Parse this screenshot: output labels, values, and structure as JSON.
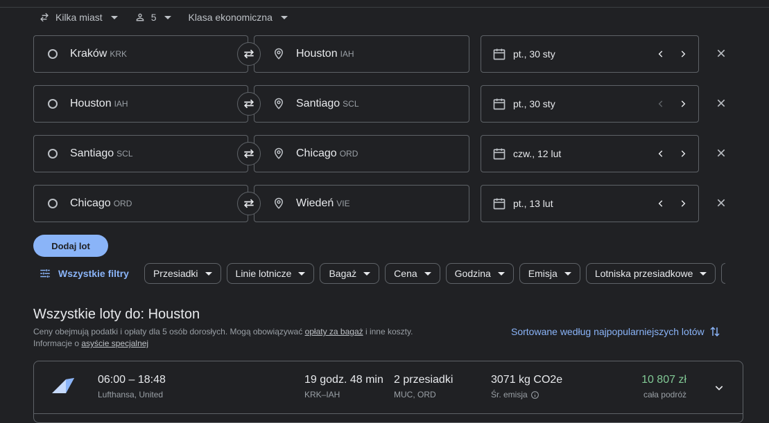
{
  "topbar": {
    "trip_type": "Kilka miast",
    "passengers": "5",
    "cabin_class": "Klasa ekonomiczna"
  },
  "legs": [
    {
      "from_city": "Kraków",
      "from_code": "KRK",
      "to_city": "Houston",
      "to_code": "IAH",
      "date": "pt., 30 sty",
      "prev_enabled": true
    },
    {
      "from_city": "Houston",
      "from_code": "IAH",
      "to_city": "Santiago",
      "to_code": "SCL",
      "date": "pt., 30 sty",
      "prev_enabled": false
    },
    {
      "from_city": "Santiago",
      "from_code": "SCL",
      "to_city": "Chicago",
      "to_code": "ORD",
      "date": "czw., 12 lut",
      "prev_enabled": true
    },
    {
      "from_city": "Chicago",
      "from_code": "ORD",
      "to_city": "Wiedeń",
      "to_code": "VIE",
      "date": "pt., 13 lut",
      "prev_enabled": true
    }
  ],
  "add_flight_label": "Dodaj lot",
  "filters": {
    "all_label": "Wszystkie filtry",
    "chips": [
      "Przesiadki",
      "Linie lotnicze",
      "Bagaż",
      "Cena",
      "Godzina",
      "Emisja",
      "Lotniska przesiadkowe"
    ]
  },
  "results": {
    "title": "Wszystkie loty do: Houston",
    "note_part1": "Ceny obejmują podatki i opłaty dla 5 osób dorosłych. Mogą obowiązywać ",
    "note_link1": "opłaty za bagaż",
    "note_part2": " i inne koszty.",
    "note_part3": "Informacje o ",
    "note_link2": "asyście specjalnej",
    "sort_label": "Sortowane według najpopularniejszych lotów"
  },
  "flight": {
    "times": "06:00 – 18:48",
    "airlines": "Lufthansa, United",
    "duration": "19 godz. 48 min",
    "route": "KRK–IAH",
    "stops": "2 przesiadki",
    "stop_airports": "MUC, ORD",
    "emissions": "3071 kg CO2e",
    "emissions_label": "Śr. emisja",
    "price": "10 807 zł",
    "price_label": "cała podróż"
  },
  "colors": {
    "background": "#202124",
    "accent": "#8ab4f8",
    "price_green": "#81c995",
    "border": "#5f6368"
  }
}
